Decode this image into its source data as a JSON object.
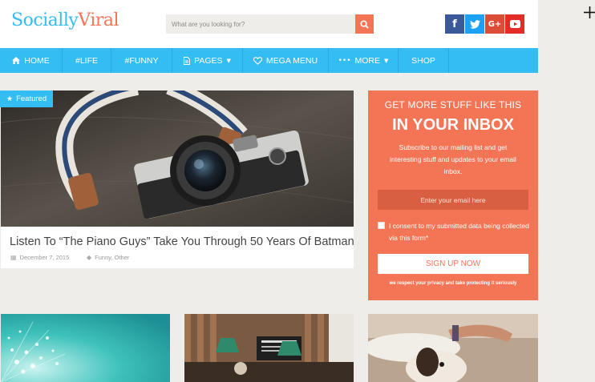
{
  "header": {
    "logo_part1": "Socially",
    "logo_part2": "Viral",
    "search_placeholder": "What are you looking for?",
    "socials": [
      {
        "icon": "facebook-icon",
        "glyph": "f"
      },
      {
        "icon": "twitter-icon",
        "glyph": "t"
      },
      {
        "icon": "google-plus-icon",
        "glyph": "G+"
      },
      {
        "icon": "youtube-icon",
        "glyph": "▶"
      }
    ]
  },
  "colors": {
    "primary": "#33bdf2",
    "accent": "#f47555",
    "background": "#efede9"
  },
  "nav": {
    "items": [
      {
        "label": "HOME",
        "icon": "home-icon"
      },
      {
        "label": "#LIFE"
      },
      {
        "label": "#FUNNY"
      },
      {
        "label": "PAGES",
        "icon": "file-icon",
        "dropdown": true
      },
      {
        "label": "MEGA MENU",
        "icon": "heart-icon"
      },
      {
        "label": "MORE",
        "icon": "dots-icon",
        "dropdown": true
      },
      {
        "label": "SHOP"
      }
    ]
  },
  "featured": {
    "badge": "Featured",
    "title": "Listen To “The Piano Guys” Take You Through 50 Years Of Batman",
    "date": "December 7, 2015",
    "categories": "Funny, Other"
  },
  "newsletter": {
    "heading1": "GET MORE STUFF LIKE THIS",
    "heading2": "IN YOUR INBOX",
    "description": "Subscribe to our mailing list and get interesting stuff and updates to your email inbox.",
    "email_placeholder": "Enter your email here",
    "consent": "I consent to my submitted data being collected via this form*",
    "button": "SIGN UP NOW",
    "privacy": "we respect your privacy and take protecting it seriously"
  }
}
